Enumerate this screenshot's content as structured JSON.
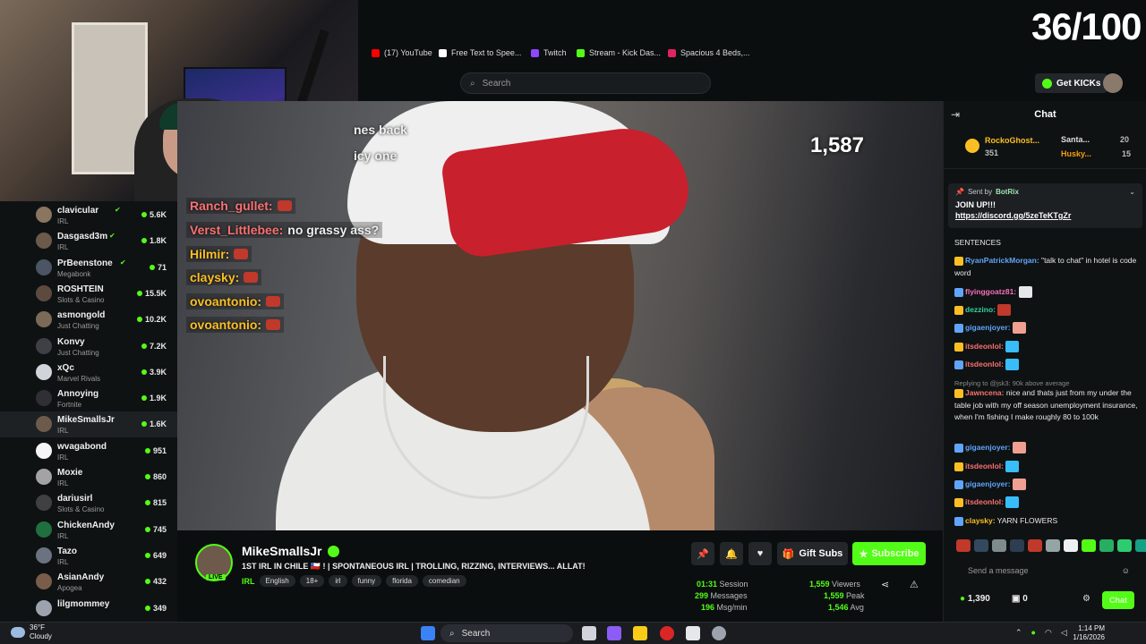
{
  "browser": {
    "bookmarks": [
      {
        "label": "(17) YouTube",
        "color": "#ff0000"
      },
      {
        "label": "Free Text to Spee...",
        "color": "#ffffff"
      },
      {
        "label": "Twitch",
        "color": "#9146ff"
      },
      {
        "label": "Stream - Kick Das...",
        "color": "#53fc18"
      },
      {
        "label": "Spacious 4 Beds,...",
        "color": "#e0245e"
      }
    ],
    "search_placeholder": "Search"
  },
  "overlay": {
    "counter": "36/100"
  },
  "header": {
    "get_kicks": "Get KICKs"
  },
  "sidebar": {
    "channels": [
      {
        "name": "clavicular",
        "category": "IRL",
        "viewers": "5.6K",
        "verified": true
      },
      {
        "name": "Dasgasd3m",
        "category": "IRL",
        "viewers": "1.8K",
        "verified": true
      },
      {
        "name": "PrBeenstone",
        "category": "Megabonk",
        "viewers": "71",
        "verified": true
      },
      {
        "name": "ROSHTEIN",
        "category": "Slots & Casino",
        "viewers": "15.5K",
        "verified": false
      },
      {
        "name": "asmongold",
        "category": "Just Chatting",
        "viewers": "10.2K",
        "verified": false
      },
      {
        "name": "Konvy",
        "category": "Just Chatting",
        "viewers": "7.2K",
        "verified": false
      },
      {
        "name": "xQc",
        "category": "Marvel Rivals",
        "viewers": "3.9K",
        "verified": false
      },
      {
        "name": "Annoying",
        "category": "Fortnite",
        "viewers": "1.9K",
        "verified": false
      },
      {
        "name": "MikeSmallsJr",
        "category": "IRL",
        "viewers": "1.6K",
        "verified": false,
        "active": true
      },
      {
        "name": "wvagabond",
        "category": "IRL",
        "viewers": "951",
        "verified": false
      },
      {
        "name": "Moxie",
        "category": "IRL",
        "viewers": "860",
        "verified": false
      },
      {
        "name": "dariusirl",
        "category": "Slots & Casino",
        "viewers": "815",
        "verified": false
      },
      {
        "name": "ChickenAndy",
        "category": "IRL",
        "viewers": "745",
        "verified": false
      },
      {
        "name": "Tazo",
        "category": "IRL",
        "viewers": "649",
        "verified": false
      },
      {
        "name": "AsianAndy",
        "category": "Apogea",
        "viewers": "432",
        "verified": false
      },
      {
        "name": "lilgmommey",
        "category": "",
        "viewers": "349",
        "verified": false
      }
    ]
  },
  "video": {
    "viewer_overlay": "1,587",
    "overlay_text_1": "nes back",
    "overlay_text_2": "icy one",
    "overlay_chat": [
      {
        "user": "Ranch_gullet:",
        "text": "",
        "color": "#f87171"
      },
      {
        "user": "Verst_Littlebee:",
        "text": "no grassy ass?",
        "color": "#f87171"
      },
      {
        "user": "Hilmir:",
        "text": "",
        "color": "#fbbf24"
      },
      {
        "user": "claysky:",
        "text": "",
        "color": "#fbbf24"
      },
      {
        "user": "ovoantonio:",
        "text": "",
        "color": "#fbbf24"
      },
      {
        "user": "ovoantonio:",
        "text": "",
        "color": "#fbbf24"
      }
    ]
  },
  "channel": {
    "name": "MikeSmallsJr",
    "live": "LIVE",
    "title": "1ST IRL IN CHILE 🇨🇱 ! | SPONTANEOUS IRL | TROLLING, RIZZING, INTERVIEWS... ALLAT!",
    "category": "IRL",
    "tags": [
      "English",
      "18+",
      "irl",
      "funny",
      "florida",
      "comedian"
    ],
    "gift_subs": "Gift Subs",
    "subscribe": "Subscribe",
    "stats": {
      "session_val": "01:31",
      "session_label": "Session",
      "messages_val": "299",
      "messages_label": "Messages",
      "msgmin_val": "196",
      "msgmin_label": "Msg/min",
      "viewers_val": "1,559",
      "viewers_label": "Viewers",
      "peak_val": "1,559",
      "peak_label": "Peak",
      "avg_val": "1,546",
      "avg_label": "Avg"
    }
  },
  "chat": {
    "title": "Chat",
    "leader_1": {
      "name": "RockoGhost...",
      "value": "351"
    },
    "leader_2": {
      "name": "Santa...",
      "value": "20"
    },
    "leader_3": {
      "name": "Husky...",
      "value": "15"
    },
    "pinned": {
      "sent_by": "Sent by",
      "user": "BotRix",
      "message": "JOIN UP!!!",
      "link": "https://discord.gg/5zeTeKTgZr"
    },
    "messages": [
      {
        "user": "",
        "text": "SENTENCES",
        "color": "#ffffff"
      },
      {
        "user": "RyanPatrickMorgan:",
        "text": "\"talk to chat\" in hotel is code word",
        "color": "#60a5fa"
      },
      {
        "user": "flyinggoatz81:",
        "text": "",
        "color": "#f472b6"
      },
      {
        "user": "dezzino:",
        "text": "",
        "color": "#34d399"
      },
      {
        "user": "gigaenjoyer:",
        "text": "",
        "color": "#60a5fa"
      },
      {
        "user": "itsdeonlol:",
        "text": "",
        "color": "#f87171"
      },
      {
        "user": "itsdeonlol:",
        "text": "",
        "color": "#f87171"
      },
      {
        "user": "Jawncena:",
        "text": "nice and thats just from my under the table job with my off season unemployment insurance, when I'm fishing I make roughly 80 to 100k",
        "color": "#f87171"
      },
      {
        "user": "gigaenjoyer:",
        "text": "",
        "color": "#60a5fa"
      },
      {
        "user": "itsdeonlol:",
        "text": "",
        "color": "#f87171"
      },
      {
        "user": "gigaenjoyer:",
        "text": "",
        "color": "#60a5fa"
      },
      {
        "user": "itsdeonlol:",
        "text": "",
        "color": "#f87171"
      },
      {
        "user": "claysky:",
        "text": "YARN FLOWERS",
        "color": "#fbbf24"
      }
    ],
    "reply_note": "Replying to @jsk3: 90k above average",
    "send_placeholder": "Send a message",
    "points": "1,390",
    "gifts": "0",
    "chat_button": "Chat"
  },
  "taskbar": {
    "temp": "36°F",
    "condition": "Cloudy",
    "search": "Search",
    "time": "1:14 PM",
    "date": "1/16/2026"
  }
}
